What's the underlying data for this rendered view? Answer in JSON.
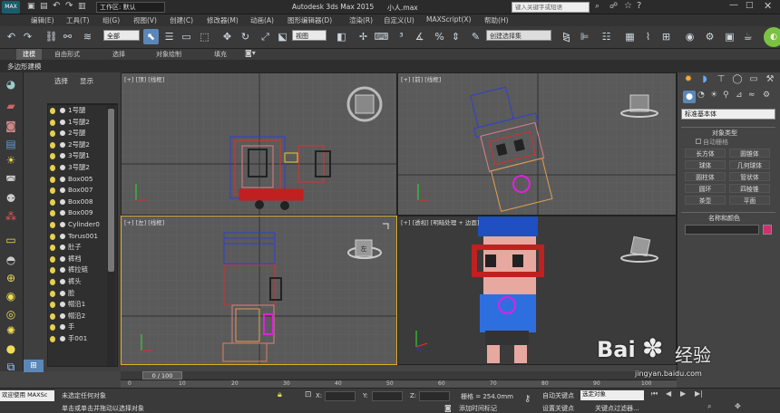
{
  "titlebar": {
    "workspace": "工作区: 默认",
    "app_title": "Autodesk 3ds Max  2015",
    "file_name": "小人.max",
    "search_placeholder": "键入关键字或短语"
  },
  "menu": [
    "编辑(E)",
    "工具(T)",
    "组(G)",
    "视图(V)",
    "创建(C)",
    "修改器(M)",
    "动画(A)",
    "图形编辑器(D)",
    "渲染(R)",
    "自定义(U)",
    "MAXScript(X)",
    "帮助(H)"
  ],
  "toolbar": {
    "filter_value": "全部",
    "refcoord_value": "视图",
    "selection_set_placeholder": "创建选择集"
  },
  "ribbon": {
    "tabs": [
      "建模",
      "自由形式",
      "选择",
      "对象绘制",
      "填充"
    ],
    "sub_label": "多边形建模"
  },
  "scene_explorer": {
    "tabs": [
      "选择",
      "显示"
    ],
    "column_header": "名称",
    "items": [
      "1号腿",
      "1号腿2",
      "2号腿",
      "2号腿2",
      "3号腿1",
      "3号腿2",
      "Box005",
      "Box007",
      "Box008",
      "Box009",
      "Cylinder0",
      "Torus001",
      "肚子",
      "裤裆",
      "裤拉链",
      "裤头",
      "脸",
      "帽沿1",
      "帽沿2",
      "手",
      "手001"
    ]
  },
  "viewports": {
    "top": "[+] [顶] [线框]",
    "front": "[+] [前] [线框]",
    "left": "[+] [左] [线框]",
    "persp": "[+] [透视] [明暗处理 + 边面]",
    "viewcube_left": "左"
  },
  "command_panel": {
    "dropdown_value": "标准基本体",
    "rollout_object_type": "对象类型",
    "autogrid": "自动栅格",
    "buttons": [
      "长方体",
      "圆锥体",
      "球体",
      "几何球体",
      "圆柱体",
      "管状体",
      "圆环",
      "四棱锥",
      "茶壶",
      "平面"
    ],
    "rollout_name_color": "名称和颜色"
  },
  "timeline": {
    "frame_counter": "0 / 100",
    "ticks": [
      "0",
      "10",
      "20",
      "30",
      "40",
      "50",
      "60",
      "70",
      "80",
      "90",
      "100"
    ]
  },
  "status": {
    "welcome": "欢迎使用 MAXSc",
    "line1": "未选定任何对象",
    "line2": "单击或单击并拖动以选择对象",
    "x_label": "X:",
    "y_label": "Y:",
    "z_label": "Z:",
    "grid_text": "栅格 = 254.0mm",
    "auto_key": "自动关键点",
    "set_key": "设置关键点",
    "selected_obj": "选定对象",
    "key_filter": "关键点过滤器...",
    "add_time_tag": "添加时间标记"
  },
  "watermark": {
    "brand": "Bai",
    "brand2": "经验",
    "url": "jingyan.baidu.com"
  }
}
